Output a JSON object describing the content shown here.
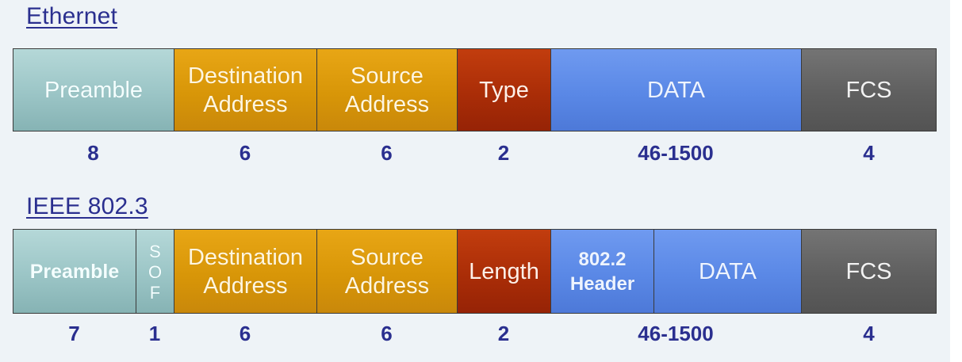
{
  "ethernet": {
    "title": "Ethernet",
    "fields": [
      {
        "lines": [
          "Preamble"
        ]
      },
      {
        "lines": [
          "Destination",
          "Address"
        ]
      },
      {
        "lines": [
          "Source",
          "Address"
        ]
      },
      {
        "lines": [
          "Type"
        ]
      },
      {
        "lines": [
          "DATA"
        ]
      },
      {
        "lines": [
          "FCS"
        ]
      }
    ],
    "sizes": [
      "8",
      "6",
      "6",
      "2",
      "46-1500",
      "4"
    ]
  },
  "ieee": {
    "title": "IEEE 802.3",
    "fields": [
      {
        "lines": [
          "Preamble"
        ]
      },
      {
        "lines": [
          "S",
          "O",
          "F"
        ]
      },
      {
        "lines": [
          "Destination",
          "Address"
        ]
      },
      {
        "lines": [
          "Source",
          "Address"
        ]
      },
      {
        "lines": [
          "Length"
        ]
      },
      {
        "lines": [
          "802.2",
          "Header"
        ]
      },
      {
        "lines": [
          "DATA"
        ]
      },
      {
        "lines": [
          "FCS"
        ]
      }
    ],
    "sizes": [
      "7",
      "1",
      "6",
      "6",
      "2",
      "46-1500",
      "4"
    ]
  },
  "colors": {
    "title": "#2a2f8f",
    "preamble": "#9bc5c6",
    "address": "#d89608",
    "type_length": "#aa2d07",
    "data": "#5a88e6",
    "fcs": "#5f5f5f"
  }
}
